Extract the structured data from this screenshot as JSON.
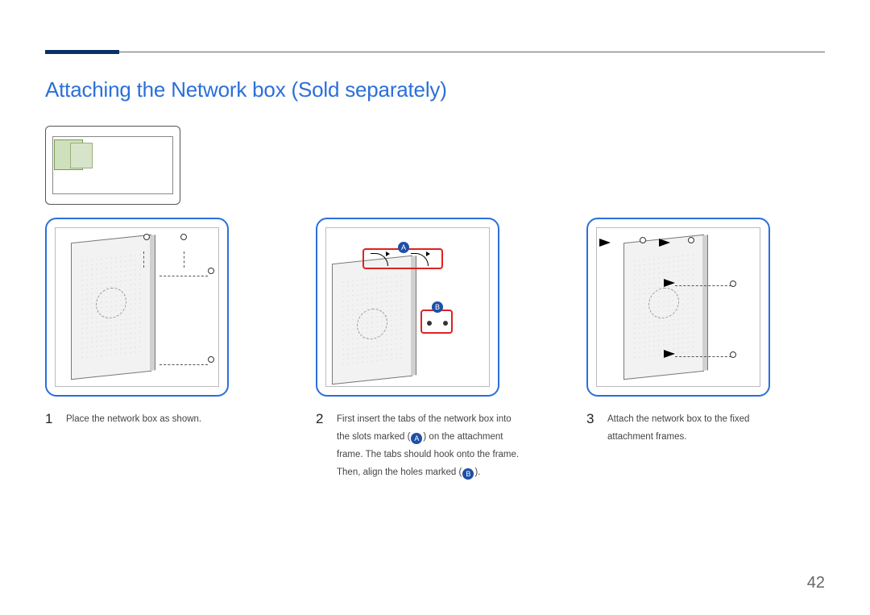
{
  "title": "Attaching the Network box (Sold separately)",
  "page_number": "42",
  "labels": {
    "A": "A",
    "B": "B"
  },
  "steps": [
    {
      "num": "1",
      "desc": "Place the network box as shown."
    },
    {
      "num": "2",
      "desc_parts": {
        "p1": "First insert the tabs of the network box into the slots marked (",
        "p2": ") on the attachment frame. The tabs should hook onto the frame. Then, align the holes marked (",
        "p3": ")."
      }
    },
    {
      "num": "3",
      "desc": "Attach the network box to the fixed attachment frames."
    }
  ]
}
